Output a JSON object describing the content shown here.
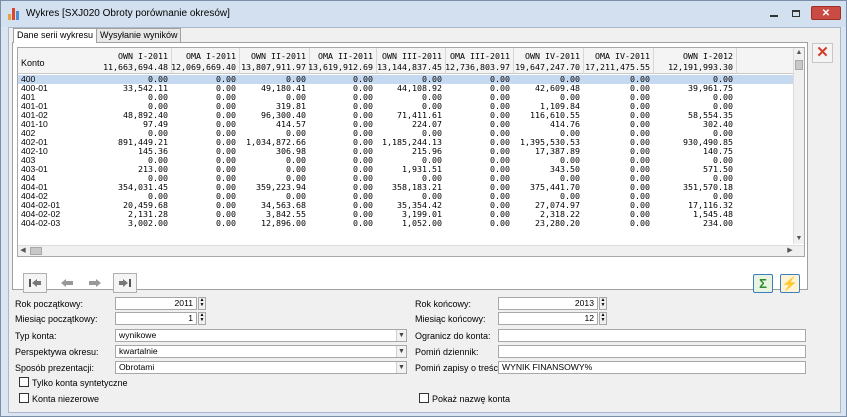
{
  "window": {
    "title": "Wykres [SXJ020 Obroty porównanie okresów]",
    "min_icon": "minimize-icon",
    "max_icon": "maximize-icon",
    "close_icon": "close-icon",
    "close_glyph": "✕"
  },
  "tabs": [
    {
      "label": "Dane serii wykresu",
      "active": true
    },
    {
      "label": "Wysyłanie wyników",
      "active": false
    }
  ],
  "grid": {
    "konto_header": "Konto",
    "columns": [
      {
        "name": "OWN I-2011",
        "total": "11,663,694.48"
      },
      {
        "name": "OMA I-2011",
        "total": "12,069,669.40"
      },
      {
        "name": "OWN II-2011",
        "total": "13,807,911.97"
      },
      {
        "name": "OMA II-2011",
        "total": "13,619,912.69"
      },
      {
        "name": "OWN III-2011",
        "total": "13,144,837.45"
      },
      {
        "name": "OMA III-2011",
        "total": "12,736,803.97"
      },
      {
        "name": "OWN IV-2011",
        "total": "19,647,247.70"
      },
      {
        "name": "OMA IV-2011",
        "total": "17,211,475.55"
      },
      {
        "name": "OWN I-2012",
        "total": "12,191,993.30"
      }
    ],
    "rows": [
      {
        "konto": "400",
        "values": [
          "0.00",
          "0.00",
          "0.00",
          "0.00",
          "0.00",
          "0.00",
          "0.00",
          "0.00",
          "0.00"
        ],
        "selected": true
      },
      {
        "konto": "400-01",
        "values": [
          "33,542.11",
          "0.00",
          "49,180.41",
          "0.00",
          "44,108.92",
          "0.00",
          "42,609.48",
          "0.00",
          "39,961.75"
        ]
      },
      {
        "konto": "401",
        "values": [
          "0.00",
          "0.00",
          "0.00",
          "0.00",
          "0.00",
          "0.00",
          "0.00",
          "0.00",
          "0.00"
        ]
      },
      {
        "konto": "401-01",
        "values": [
          "0.00",
          "0.00",
          "319.81",
          "0.00",
          "0.00",
          "0.00",
          "1,109.84",
          "0.00",
          "0.00"
        ]
      },
      {
        "konto": "401-02",
        "values": [
          "48,892.40",
          "0.00",
          "96,300.40",
          "0.00",
          "71,411.61",
          "0.00",
          "116,610.55",
          "0.00",
          "58,554.35"
        ]
      },
      {
        "konto": "401-10",
        "values": [
          "97.49",
          "0.00",
          "414.57",
          "0.00",
          "224.07",
          "0.00",
          "414.76",
          "0.00",
          "302.40"
        ]
      },
      {
        "konto": "402",
        "values": [
          "0.00",
          "0.00",
          "0.00",
          "0.00",
          "0.00",
          "0.00",
          "0.00",
          "0.00",
          "0.00"
        ]
      },
      {
        "konto": "402-01",
        "values": [
          "891,449.21",
          "0.00",
          "1,034,872.66",
          "0.00",
          "1,185,244.13",
          "0.00",
          "1,395,530.53",
          "0.00",
          "930,490.85"
        ]
      },
      {
        "konto": "402-10",
        "values": [
          "145.36",
          "0.00",
          "306.98",
          "0.00",
          "215.96",
          "0.00",
          "17,387.89",
          "0.00",
          "140.75"
        ]
      },
      {
        "konto": "403",
        "values": [
          "0.00",
          "0.00",
          "0.00",
          "0.00",
          "0.00",
          "0.00",
          "0.00",
          "0.00",
          "0.00"
        ]
      },
      {
        "konto": "403-01",
        "values": [
          "213.00",
          "0.00",
          "0.00",
          "0.00",
          "1,931.51",
          "0.00",
          "343.50",
          "0.00",
          "571.50"
        ]
      },
      {
        "konto": "404",
        "values": [
          "0.00",
          "0.00",
          "0.00",
          "0.00",
          "0.00",
          "0.00",
          "0.00",
          "0.00",
          "0.00"
        ]
      },
      {
        "konto": "404-01",
        "values": [
          "354,031.45",
          "0.00",
          "359,223.94",
          "0.00",
          "358,183.21",
          "0.00",
          "375,441.70",
          "0.00",
          "351,570.18"
        ]
      },
      {
        "konto": "404-02",
        "values": [
          "0.00",
          "0.00",
          "0.00",
          "0.00",
          "0.00",
          "0.00",
          "0.00",
          "0.00",
          "0.00"
        ]
      },
      {
        "konto": "404-02-01",
        "values": [
          "20,459.68",
          "0.00",
          "34,563.68",
          "0.00",
          "35,354.42",
          "0.00",
          "27,074.97",
          "0.00",
          "17,116.32"
        ]
      },
      {
        "konto": "404-02-02",
        "values": [
          "2,131.28",
          "0.00",
          "3,842.55",
          "0.00",
          "3,199.01",
          "0.00",
          "2,318.22",
          "0.00",
          "1,545.48"
        ]
      },
      {
        "konto": "404-02-03",
        "values": [
          "3,002.00",
          "0.00",
          "12,896.00",
          "0.00",
          "1,052.00",
          "0.00",
          "23,280.20",
          "0.00",
          "234.00"
        ]
      }
    ]
  },
  "toolbar": {
    "first_icon": "first-record-icon",
    "prev_icon": "previous-icon",
    "next_icon": "next-icon",
    "last_icon": "last-record-icon",
    "sum_icon": "sum-icon",
    "sum_glyph": "Σ",
    "run_icon": "run-report-icon",
    "run_glyph": "⚡",
    "delete_glyph": "✕"
  },
  "form": {
    "rok_poczatkowy_label": "Rok początkowy:",
    "rok_poczatkowy": "2011",
    "miesiac_poczatkowy_label": "Miesiąc początkowy:",
    "miesiac_poczatkowy": "1",
    "typ_konta_label": "Typ konta:",
    "typ_konta": "wynikowe",
    "perspektywa_label": "Perspektywa okresu:",
    "perspektywa": "kwartalnie",
    "sposob_label": "Sposób prezentacji:",
    "sposob": "Obrotami",
    "tylko_label": "Tylko konta syntetyczne",
    "niezerowe_label": "Konta niezerowe",
    "rok_koncowy_label": "Rok końcowy:",
    "rok_koncowy": "2013",
    "miesiac_koncowy_label": "Miesiąc końcowy:",
    "miesiac_koncowy": "12",
    "ogranicz_label": "Ogranicz do konta:",
    "ogranicz": "",
    "pomin_dziennik_label": "Pomiń dziennik:",
    "pomin_dziennik": "",
    "pomin_zapisy_label": "Pomiń zapisy o treści:",
    "pomin_zapisy": "WYNIK FINANSOWY%",
    "pokaz_label": "Pokaż nazwę konta"
  },
  "colors": {
    "close_red": "#c94b43",
    "selected_row": "#c5d9f1",
    "delete_red": "#d43b2a"
  }
}
